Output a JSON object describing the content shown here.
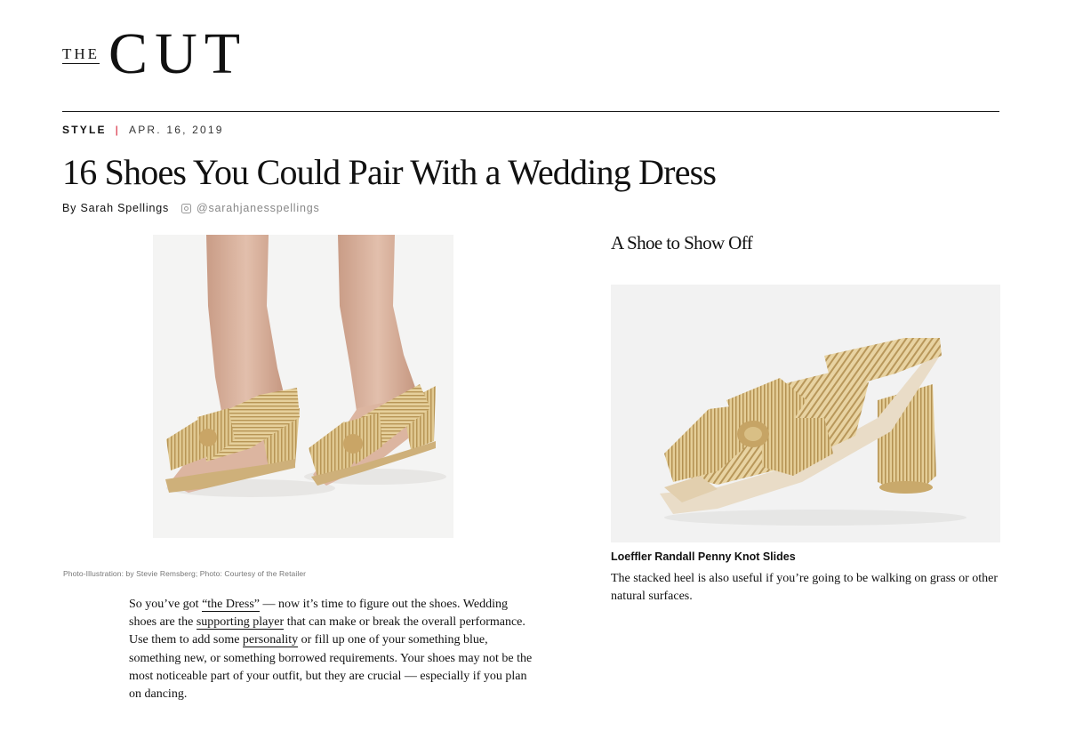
{
  "masthead": {
    "logo_small": "THE",
    "logo_large": "CUT"
  },
  "article": {
    "rubric": "STYLE",
    "separator": "|",
    "date": "APR. 16, 2019",
    "headline": "16 Shoes You Could Pair With a Wedding Dress",
    "byline": "By Sarah Spellings",
    "social_icon": "instagram-icon",
    "social_handle": "@sarahjanesspellings",
    "caption": "Photo-Illustration: by Stevie Remsberg; Photo: Courtesy of the Retailer",
    "body": {
      "t1": "So you’ve got ",
      "link1": "“the Dress”",
      "t2": " — now it’s time to figure out the shoes. Wedding shoes are the ",
      "link2": "supporting player",
      "t3": " that can make or break the overall performance. Use them to add some ",
      "link3": "personality",
      "t4": " or fill up one of your something blue, something new, or something borrowed requirements. Your shoes may not be the most noticeable part of your outfit, but they are crucial — especially if you plan on dancing."
    }
  },
  "section": {
    "heading": "A Shoe to Show Off",
    "product_name": "Loeffler Randall Penny Knot Slides",
    "product_description": "The stacked heel is also useful if you’re going to be walking on grass or other natural surfaces."
  },
  "colors": {
    "accent_red": "#d0021b",
    "gold": "#d8c08a",
    "text": "#111111"
  }
}
